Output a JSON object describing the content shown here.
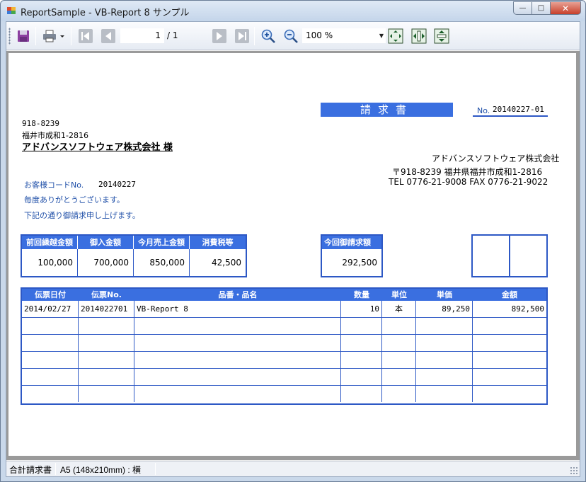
{
  "window": {
    "title": "ReportSample - VB-Report 8 サンプル",
    "min_glyph": "—",
    "max_glyph": "□",
    "close_glyph": "✕"
  },
  "toolbar": {
    "icons": [
      "save-icon",
      "print-icon",
      "first-page-icon",
      "prev-page-icon",
      "next-page-icon",
      "last-page-icon",
      "zoom-in-icon",
      "zoom-out-icon",
      "fit-page-icon",
      "fit-width-icon",
      "fit-height-icon"
    ],
    "current_page": "1",
    "total_pages": "/ 1",
    "zoom": "100 %"
  },
  "report": {
    "title": "請求書",
    "no_label": "No.",
    "no_value": "20140227-01",
    "customer_zip": "918-8239",
    "customer_address": "福井市成和1-2816",
    "customer_name": "アドバンスソフトウェア株式会社 様",
    "company_name": "アドバンスソフトウェア株式会社",
    "company_address": "〒918-8239 福井県福井市成和1-2816",
    "company_tel": "TEL 0776-21-9008 FAX 0776-21-9022",
    "customer_code_label": "お客様コードNo.",
    "customer_code": "20140227",
    "greeting1": "毎度ありがとうございます。",
    "greeting2": "下記の通り御請求申し上げます。",
    "summary": {
      "headers": [
        "前回繰越金額",
        "御入金額",
        "今月売上金額",
        "消費税等"
      ],
      "values": [
        "100,000",
        "700,000",
        "850,000",
        "42,500"
      ]
    },
    "bill_label": "今回御請求額",
    "bill_amount": "292,500",
    "detail": {
      "headers": [
        "伝票日付",
        "伝票No.",
        "品番・品名",
        "数量",
        "単位",
        "単価",
        "金額"
      ],
      "rows": [
        [
          "2014/02/27",
          "2014022701",
          "VB-Report 8",
          "10",
          "本",
          "89,250",
          "892,500"
        ],
        [
          "",
          "",
          "",
          "",
          "",
          "",
          ""
        ],
        [
          "",
          "",
          "",
          "",
          "",
          "",
          ""
        ],
        [
          "",
          "",
          "",
          "",
          "",
          "",
          ""
        ],
        [
          "",
          "",
          "",
          "",
          "",
          "",
          ""
        ],
        [
          "",
          "",
          "",
          "",
          "",
          "",
          ""
        ]
      ]
    }
  },
  "status": {
    "report_name": "合計請求書",
    "paper": "A5 (148x210mm) : 横"
  },
  "colors": {
    "header_blue": "#3a6fe0",
    "border_blue": "#2d58c5",
    "label_blue": "#1f4fa8"
  }
}
